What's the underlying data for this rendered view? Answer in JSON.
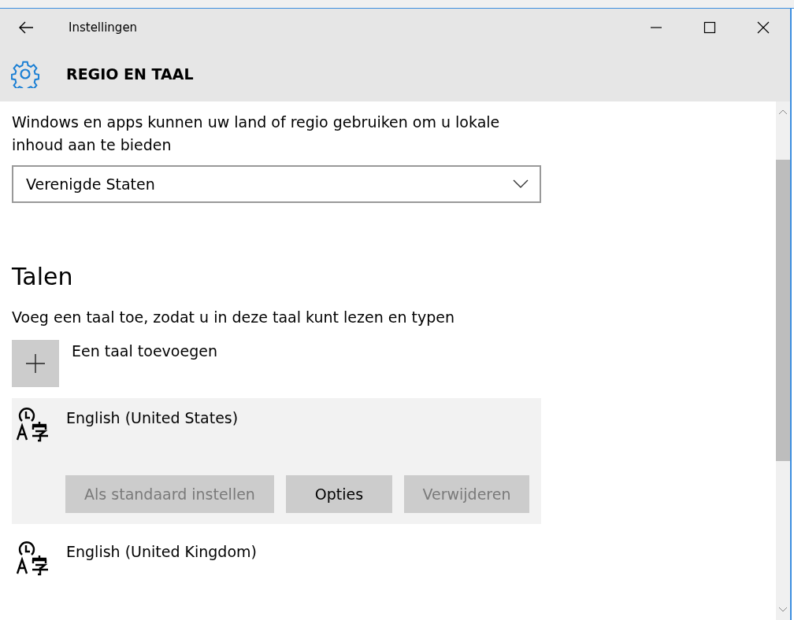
{
  "window": {
    "title": "Instellingen"
  },
  "header": {
    "title": "REGIO EN TAAL"
  },
  "region": {
    "description": "Windows en apps kunnen uw land of regio gebruiken om u lokale inhoud aan te bieden",
    "value": "Verenigde Staten"
  },
  "languages": {
    "heading": "Talen",
    "description": "Voeg een taal toe, zodat u in deze taal kunt lezen en typen",
    "add_label": "Een taal toevoegen",
    "items": [
      {
        "name": "English (United States)",
        "selected": true,
        "buttons": [
          {
            "label": "Als standaard instellen",
            "disabled": true
          },
          {
            "label": "Opties",
            "disabled": false
          },
          {
            "label": "Verwijderen",
            "disabled": true
          }
        ]
      },
      {
        "name": "English (United Kingdom)",
        "selected": false
      }
    ]
  }
}
